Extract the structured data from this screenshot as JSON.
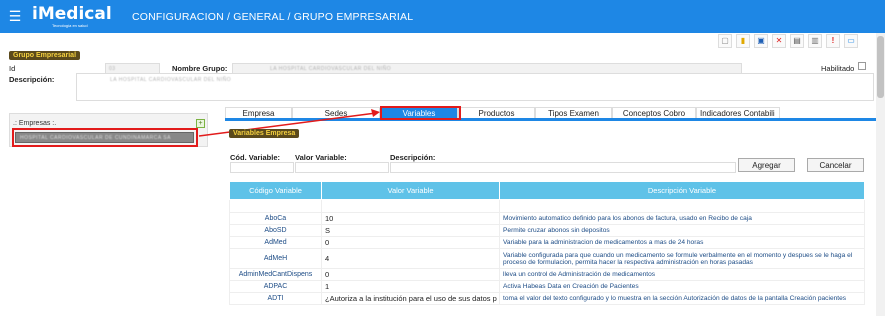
{
  "header": {
    "menu_icon": "hamburger-icon",
    "logo_text": "iMedical",
    "logo_tagline": "Tecnología en salud",
    "breadcrumb": "CONFIGURACION  /  GENERAL  /  GRUPO EMPRESARIAL"
  },
  "toolbar": {
    "icons": [
      "new-document-icon",
      "folder-icon",
      "save-icon",
      "delete-icon",
      "print-icon",
      "export-icon",
      "alert-icon",
      "comment-icon"
    ]
  },
  "grupo": {
    "section_label": "Grupo Empresarial",
    "id_label": "Id",
    "id_value": "03",
    "nombre_label": "Nombre Grupo:",
    "nombre_value": "LA HOSPITAL CARDIOVASCULAR DEL NIÑO",
    "descripcion_label": "Descripción:",
    "descripcion_value": "LA HOSPITAL CARDIOVASCULAR DEL NIÑO",
    "habilitado_label": "Habilitado"
  },
  "empresas": {
    "title": ".: Empresas :.",
    "items": [
      "HOSPITAL CARDIOVASCULAR DE CUNDINAMARCA SA"
    ]
  },
  "tabs": [
    {
      "label": "Empresa"
    },
    {
      "label": "Sedes"
    },
    {
      "label": "Variables"
    },
    {
      "label": "Productos"
    },
    {
      "label": "Tipos Examen"
    },
    {
      "label": "Conceptos Cobro"
    },
    {
      "label": "Indicadores Contabili"
    }
  ],
  "variables": {
    "section_label": "Variables Empresa",
    "cod_label": "Cód. Variable:",
    "valor_label": "Valor Variable:",
    "desc_label": "Descripción:",
    "agregar": "Agregar",
    "cancelar": "Cancelar",
    "columns": [
      "Código Variable",
      "Valor Variable",
      "Descripción Variable"
    ],
    "rows": [
      {
        "code": "AboCa",
        "value": "10",
        "desc": "Movimiento automatico definido para los abonos de factura, usado en Recibo de caja"
      },
      {
        "code": "AboSD",
        "value": "S",
        "desc": "Permite cruzar abonos sin depositos"
      },
      {
        "code": "AdMed",
        "value": "0",
        "desc": "Variable para la administracion de medicamentos a mas de 24 horas"
      },
      {
        "code": "AdMeH",
        "value": "4",
        "desc": "Variable configurada para que cuando un medicamento se formule verbalmente en el momento y despues se le haga el proceso de formulacion, permita hacer la respectiva administración en horas pasadas"
      },
      {
        "code": "AdminMedCantDispens",
        "value": "0",
        "desc": "lleva un control de Administración de medicamentos"
      },
      {
        "code": "ADPAC",
        "value": "1",
        "desc": "Activa Habeas Data en Creación de Pacientes"
      },
      {
        "code": "ADTI",
        "value": "¿Autoriza a la institución para el uso de sus datos p",
        "desc": "toma el valor del texto configurado y lo muestra en la sección Autorización de datos de la pantalla Creación pacientes"
      }
    ]
  },
  "colors": {
    "brand": "#1e87e5",
    "section_label_bg": "#5b4a1c",
    "section_label_fg": "#f4d03f",
    "table_header": "#5fc2e8",
    "highlight": "#e21b1b"
  }
}
